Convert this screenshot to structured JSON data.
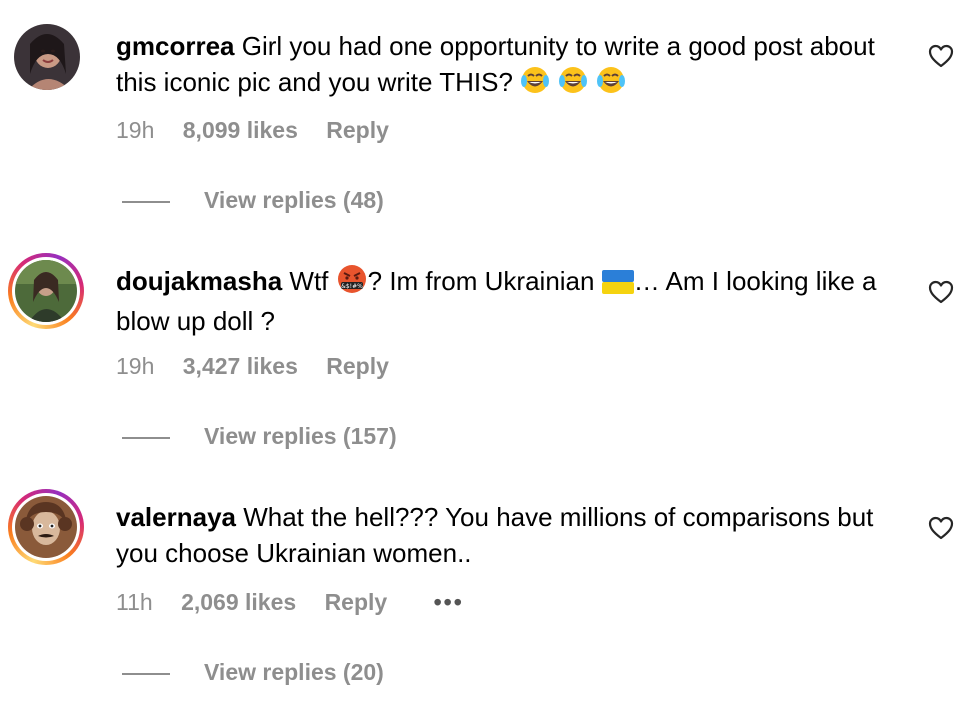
{
  "comments": [
    {
      "username": "gmcorrea",
      "text": "Girl you had one opportunity to write a good post about this iconic pic and you write THIS?",
      "emoji": [
        "face-with-tears-of-joy",
        "face-with-tears-of-joy",
        "face-with-tears-of-joy"
      ],
      "time": "19h",
      "likes": "8,099 likes",
      "reply_label": "Reply",
      "view_replies": "View replies (48)",
      "has_story_ring": false
    },
    {
      "username": "doujakmasha",
      "text_before": "Wtf",
      "emoji_mid": "face-with-symbols-on-mouth",
      "text_mid": "? Im from Ukrainian",
      "flag": "ukraine-flag",
      "text_after": "… Am I looking like a blow up doll ?",
      "time": "19h",
      "likes": "3,427 likes",
      "reply_label": "Reply",
      "view_replies": "View replies (157)",
      "has_story_ring": true
    },
    {
      "username": "valernaya",
      "text": "What the hell??? You have millions of comparisons but you choose Ukrainian women..",
      "time": "11h",
      "likes": "2,069 likes",
      "reply_label": "Reply",
      "more": "•••",
      "view_replies": "View replies (20)",
      "has_story_ring": true
    }
  ],
  "colors": {
    "text": "#000000",
    "secondary": "#8e8e8e",
    "story_gradient": [
      "#feda75",
      "#fa7e1e",
      "#d62976",
      "#962fbf"
    ]
  },
  "icons": {
    "like": "heart-outline-icon",
    "more": "more-options-icon"
  }
}
